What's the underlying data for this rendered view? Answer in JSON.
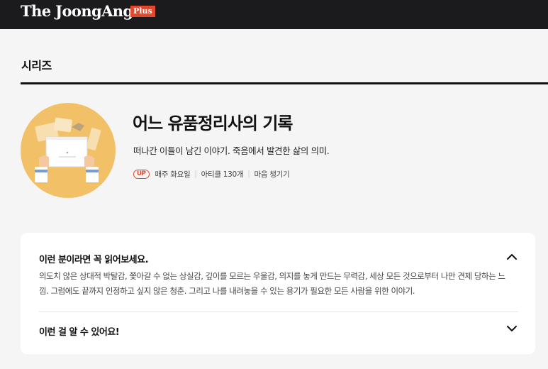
{
  "header": {
    "logo_text": "The JoongAng",
    "plus_badge": "Plus",
    "brand_color": "#e0492e"
  },
  "section": {
    "title": "시리즈"
  },
  "series": {
    "thumbnail": "hands-holding-box-illustration",
    "title": "어느 유품정리사의 기록",
    "description": "떠나간 이들이 남긴 이야기. 죽음에서 발견한 삶의 의미.",
    "badge": "UP",
    "schedule": "매주 화요일",
    "article_count": "아티클 130개",
    "category": "마음 챙기기"
  },
  "accordion": {
    "items": [
      {
        "heading": "이런 분이라면 꼭 읽어보세요.",
        "state": "expanded",
        "icon": "chevron-up-icon",
        "body": "의도치 않은 상대적 박탈감, 쫓아갈 수 없는 상실감, 깊이를 모르는 우울감, 의지를 놓게 만드는 무력감, 세상 모든 것으로부터 나만 견제 당하는 느낌. 그럼에도 끝까지 인정하고 싶지 않은 청춘. 그리고 나를 내려놓을 수 있는 용기가 필요한 모든 사람을 위한 이야기."
      },
      {
        "heading": "이런 걸 알 수 있어요!",
        "state": "collapsed",
        "icon": "chevron-down-icon"
      }
    ]
  }
}
